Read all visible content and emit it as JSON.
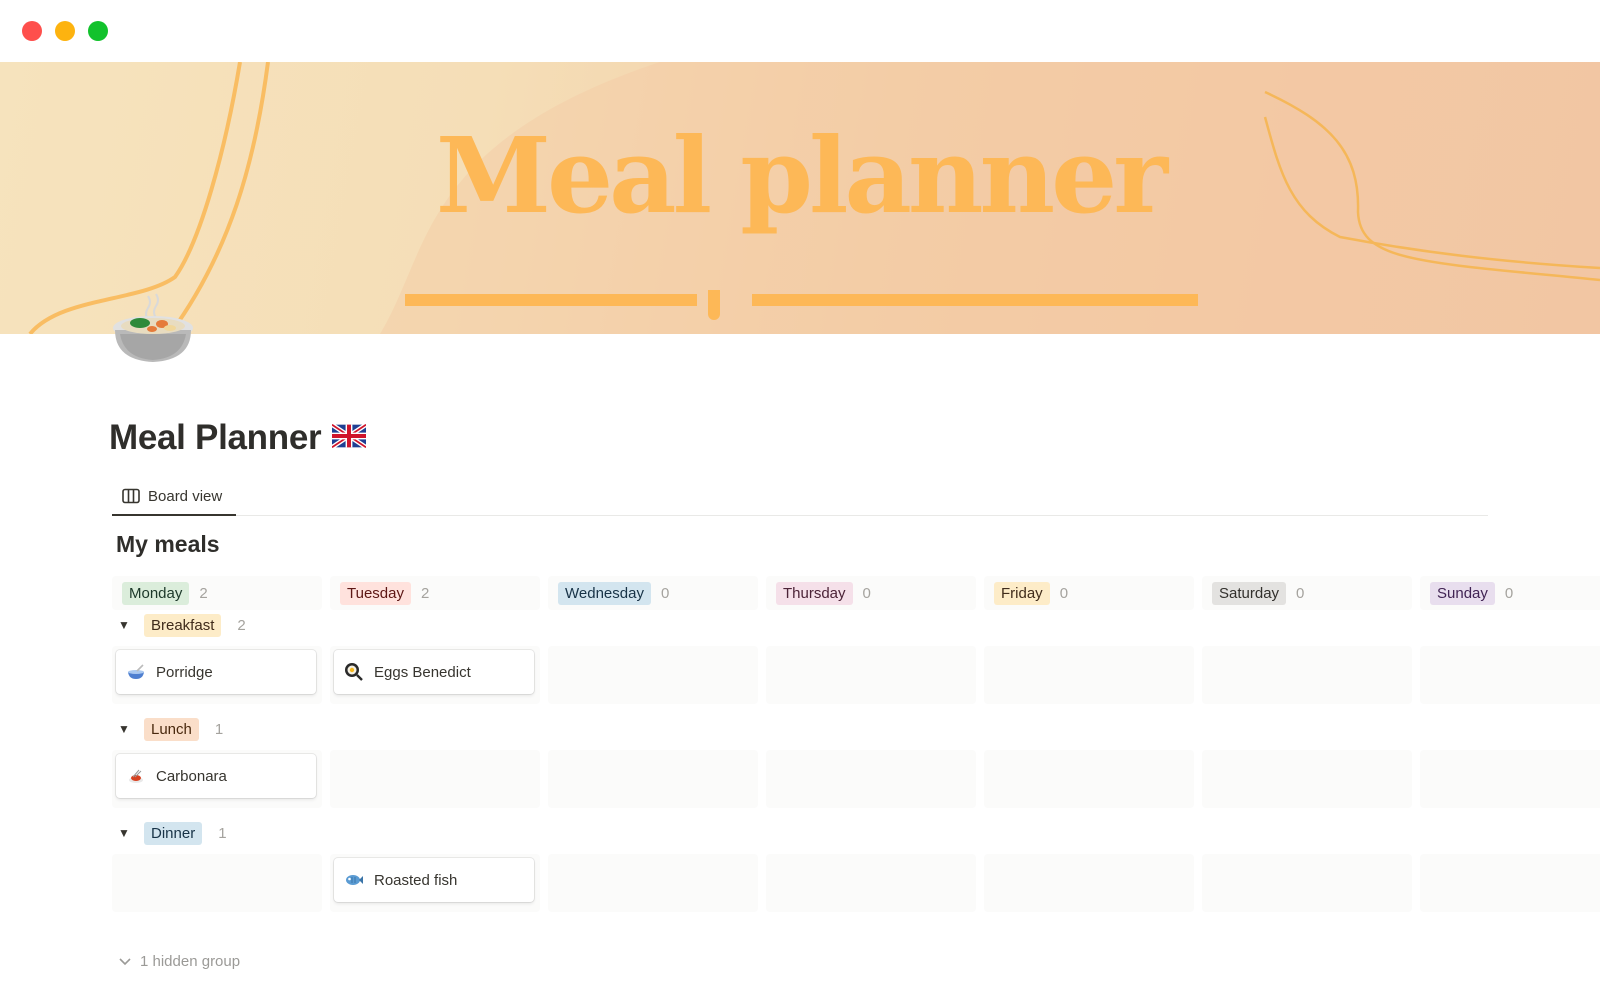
{
  "window": {
    "controls": [
      "close",
      "minimize",
      "maximize"
    ]
  },
  "cover": {
    "title": "Meal planner",
    "colors": {
      "background_left": "#f6e3bd",
      "background_right": "#f1c4a3",
      "title": "#fdb857"
    }
  },
  "page": {
    "icon": "pot-of-food-emoji",
    "title": "Meal Planner",
    "title_emoji": "uk-flag-emoji"
  },
  "tabs": [
    {
      "label": "Board view",
      "icon": "board-icon",
      "active": true
    }
  ],
  "database": {
    "title": "My meals",
    "columns": [
      {
        "label": "Monday",
        "count": "2",
        "bg": "#dbeddb",
        "fg": "#1c3829"
      },
      {
        "label": "Tuesday",
        "count": "2",
        "bg": "#ffe2dd",
        "fg": "#5d1715"
      },
      {
        "label": "Wednesday",
        "count": "0",
        "bg": "#d3e5ef",
        "fg": "#183347"
      },
      {
        "label": "Thursday",
        "count": "0",
        "bg": "#f5e0e9",
        "fg": "#4c2337"
      },
      {
        "label": "Friday",
        "count": "0",
        "bg": "#fdecc8",
        "fg": "#402c1b"
      },
      {
        "label": "Saturday",
        "count": "0",
        "bg": "#e3e2e0",
        "fg": "#32302c"
      },
      {
        "label": "Sunday",
        "count": "0",
        "bg": "#e8deee",
        "fg": "#412454"
      }
    ],
    "groups": [
      {
        "label": "Breakfast",
        "count": "2",
        "bg": "#fdecc8",
        "fg": "#402c1b",
        "cards": [
          {
            "column": 0,
            "label": "Porridge",
            "icon": "bowl-with-spoon-emoji"
          },
          {
            "column": 1,
            "label": "Eggs Benedict",
            "icon": "frying-pan-egg-emoji"
          }
        ]
      },
      {
        "label": "Lunch",
        "count": "1",
        "bg": "#fadec9",
        "fg": "#49290e",
        "cards": [
          {
            "column": 0,
            "label": "Carbonara",
            "icon": "spaghetti-emoji"
          }
        ]
      },
      {
        "label": "Dinner",
        "count": "1",
        "bg": "#d3e5ef",
        "fg": "#183347",
        "cards": [
          {
            "column": 1,
            "label": "Roasted fish",
            "icon": "fish-emoji"
          }
        ]
      }
    ],
    "hidden_groups": "1 hidden group"
  }
}
